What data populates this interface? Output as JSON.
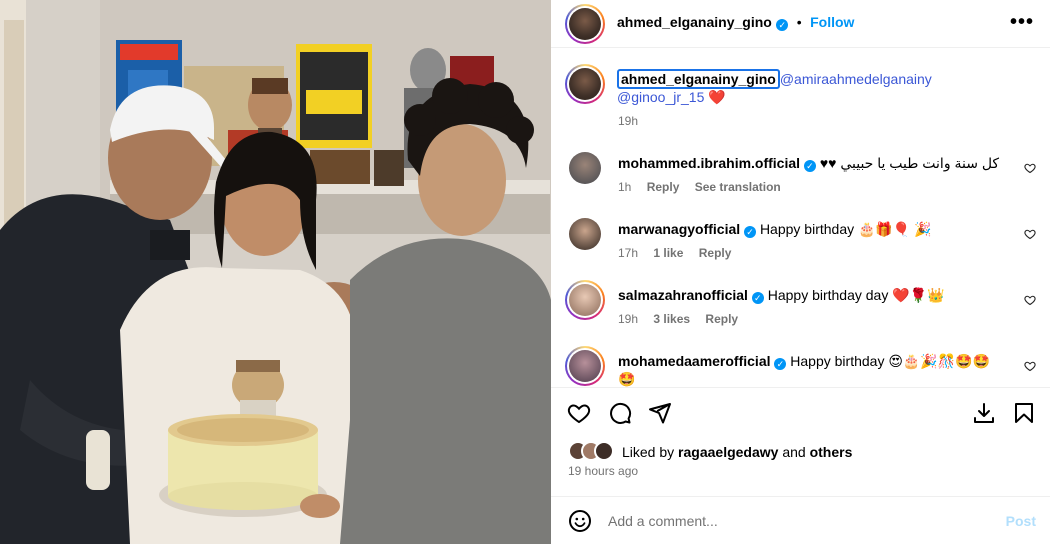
{
  "post": {
    "author": "ahmed_elganainy_gino",
    "follow_label": "Follow",
    "more_icon": "more-horizontal-icon",
    "caption": {
      "username": "ahmed_elganainy_gino",
      "mention1": "@amiraahmedelganainy",
      "mention2": "@ginoo_jr_15",
      "emoji": "❤️",
      "time": "19h"
    }
  },
  "comments": [
    {
      "username": "mohammed.ibrahim.official",
      "text": "كل سنة وانت طيب يا حبيبي ♥♥",
      "time": "1h",
      "likes": "",
      "reply": "Reply",
      "translate": "See translation"
    },
    {
      "username": "marwanagyofficial",
      "text": "Happy birthday 🎂🎁🎈 🎉",
      "time": "17h",
      "likes": "1 like",
      "reply": "Reply"
    },
    {
      "username": "salmazahranofficial",
      "text": "Happy birthday day ❤️🌹👑",
      "time": "19h",
      "likes": "3 likes",
      "reply": "Reply"
    },
    {
      "username": "mohamedaamerofficial",
      "text": "Happy birthday 😍🎂🎉🎊🤩🤩",
      "text2": "🤩"
    }
  ],
  "liked_by": {
    "prefix": "Liked by",
    "user": "ragaaelgedawy",
    "and": "and",
    "others": "others"
  },
  "timestamp": "19 hours ago",
  "composer": {
    "placeholder": "Add a comment...",
    "post_label": "Post"
  },
  "colors": {
    "link": "#0095f6",
    "mention": "#3b57d6",
    "heart": "#ff3040"
  }
}
